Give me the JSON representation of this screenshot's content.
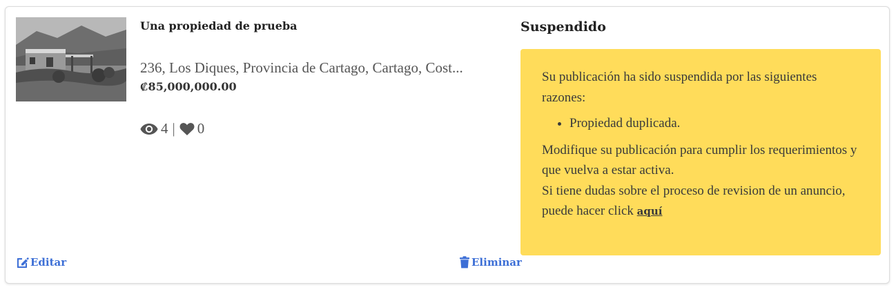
{
  "listing": {
    "title": "Una propiedad de prueba",
    "address": "236, Los Diques, Provincia de Cartago, Cartago, Cost...",
    "price": "₡85,000,000.00",
    "views": "4",
    "separator": "|",
    "likes": "0",
    "image_icon": "house-photo"
  },
  "actions": {
    "edit_label": "Editar",
    "edit_icon": "edit-icon",
    "delete_label": "Eliminar",
    "delete_icon": "trash-icon"
  },
  "status": {
    "title": "Suspendido",
    "intro": "Su publicación ha sido suspendida por las siguientes razones:",
    "reasons": [
      "Propiedad duplicada."
    ],
    "instruction": "Modifique su publicación para cumplir los requerimientos y que vuelva a estar activa.",
    "help_text": "Si tiene dudas sobre el proceso de revision de un anuncio, puede hacer click ",
    "help_link": "aquí"
  },
  "colors": {
    "accent": "#3d6fd6",
    "alert_bg": "#ffdc5a",
    "text_muted": "#555555"
  }
}
